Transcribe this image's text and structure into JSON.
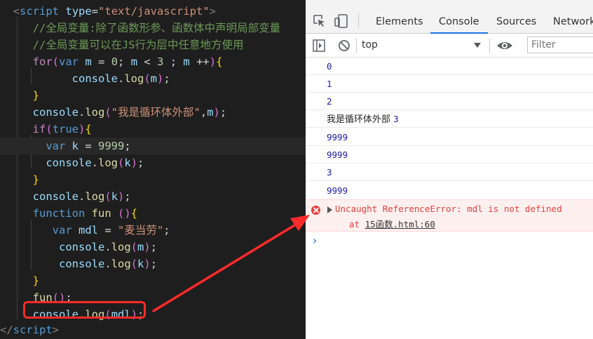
{
  "editor": {
    "lines": {
      "l1": {
        "lt": "<",
        "tag": "script",
        "attr": "type",
        "eq": "=",
        "val": "\"text/javascript\"",
        "gt": ">"
      },
      "l2": {
        "comment": "//全局变量:除了函数形参、函数体中声明局部变量"
      },
      "l3": {
        "comment": "//全局变量可以在JS行为层中任意地方使用"
      },
      "l4": {
        "kw": "for",
        "op": "(",
        "decl": "var",
        "name": "m",
        "rest1": " = ",
        "n0": "0",
        "rest2": "; ",
        "name2": "m",
        "rest3": " < ",
        "n3": "3",
        "rest4": " ; ",
        "name3": "m",
        "rest5": " ++",
        "cp": ")",
        "ob": "{"
      },
      "l5": {
        "obj": "console",
        "dot": ".",
        "fn": "log",
        "op": "(",
        "arg": "m",
        "cp": ")",
        "semi": ";"
      },
      "l6": {
        "cb": "}"
      },
      "l7": {
        "obj": "console",
        "dot": ".",
        "fn": "log",
        "op": "(",
        "str": "\"我是循环体外部\"",
        "comma": ",",
        "arg": "m",
        "cp": ")",
        "semi": ";"
      },
      "l8": {
        "kw": "if",
        "op": "(",
        "val": "true",
        "cp": ")",
        "ob": "{"
      },
      "l9": {
        "decl": "var",
        "name": "k",
        "eq": " = ",
        "num": "9999",
        "semi": ";"
      },
      "l10": {
        "obj": "console",
        "dot": ".",
        "fn": "log",
        "op": "(",
        "arg": "k",
        "cp": ")",
        "semi": ";"
      },
      "l11": {
        "cb": "}"
      },
      "l12": {
        "obj": "console",
        "dot": ".",
        "fn": "log",
        "op": "(",
        "arg": "k",
        "cp": ")",
        "semi": ";"
      },
      "l13": {
        "kw": "function",
        "name": "fun",
        "op": " (",
        "cp": ")",
        "ob": "{"
      },
      "l14": {
        "decl": "var",
        "name": "mdl",
        "eq": " = ",
        "str": "\"麦当劳\"",
        "semi": ";"
      },
      "l15": {
        "obj": "console",
        "dot": ".",
        "fn": "log",
        "op": "(",
        "arg": "m",
        "cp": ")",
        "semi": ";"
      },
      "l16": {
        "obj": "console",
        "dot": ".",
        "fn": "log",
        "op": "(",
        "arg": "k",
        "cp": ")",
        "semi": ";"
      },
      "l17": {
        "cb": "}"
      },
      "l18": {
        "fn": "fun",
        "op": "(",
        "cp": ")",
        "semi": ";"
      },
      "l19": {
        "obj": "console",
        "dot": ".",
        "fn": "log",
        "op": "(",
        "arg": "mdl",
        "cp": ")",
        "semi": ";"
      },
      "l20": {
        "lt": "</",
        "tag": "script",
        "gt": ">"
      }
    }
  },
  "devtools": {
    "tabs": {
      "elements": "Elements",
      "console": "Console",
      "sources": "Sources",
      "network": "Network"
    },
    "toolbar": {
      "context": "top",
      "filter_placeholder": "Filter"
    },
    "console": {
      "messages": {
        "m1": "0",
        "m2": "1",
        "m3": "2",
        "m4_text": "我是循环体外部",
        "m4_num": "3",
        "m5": "9999",
        "m6": "9999",
        "m7": "3",
        "m8": "9999"
      },
      "error": {
        "message": "Uncaught ReferenceError: mdl is not defined",
        "at": "at",
        "source": "15函数.html:60"
      },
      "prompt": "›"
    }
  },
  "colors": {
    "highlight_box": "#ff2a2a",
    "active_tab": "#1a73e8",
    "error_text": "#e8403a"
  }
}
